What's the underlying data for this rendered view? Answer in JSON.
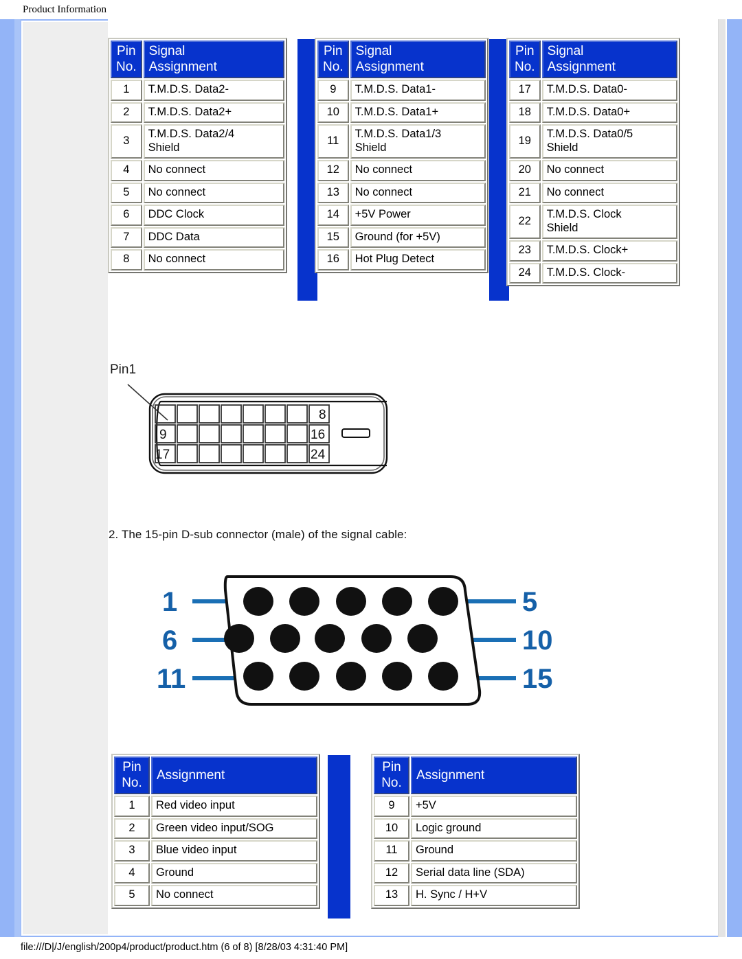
{
  "header": {
    "title": "Product Information"
  },
  "footer": {
    "path": "file:///D|/J/english/200p4/product/product.htm (6 of 8) [8/28/03 4:31:40 PM]"
  },
  "dvi_table": {
    "headers": {
      "pin": "Pin\nNo.",
      "pin_line1": "Pin",
      "pin_line2": "No.",
      "assignment_line1": "Signal",
      "assignment_line2": "Assignment"
    },
    "accent_color": "#0733cc",
    "columns": [
      {
        "rows": [
          {
            "pin": "1",
            "signal": "T.M.D.S. Data2-"
          },
          {
            "pin": "2",
            "signal": "T.M.D.S. Data2+"
          },
          {
            "pin": "3",
            "signal": "T.M.D.S. Data2/4\nShield",
            "signal_l1": "T.M.D.S. Data2/4",
            "signal_l2": "Shield"
          },
          {
            "pin": "4",
            "signal": "No connect"
          },
          {
            "pin": "5",
            "signal": "No connect"
          },
          {
            "pin": "6",
            "signal": "DDC Clock"
          },
          {
            "pin": "7",
            "signal": "DDC Data"
          },
          {
            "pin": "8",
            "signal": "No connect"
          }
        ]
      },
      {
        "rows": [
          {
            "pin": "9",
            "signal": "T.M.D.S. Data1-"
          },
          {
            "pin": "10",
            "signal": "T.M.D.S. Data1+"
          },
          {
            "pin": "11",
            "signal": "T.M.D.S. Data1/3\nShield",
            "signal_l1": "T.M.D.S. Data1/3",
            "signal_l2": "Shield"
          },
          {
            "pin": "12",
            "signal": "No connect"
          },
          {
            "pin": "13",
            "signal": "No connect"
          },
          {
            "pin": "14",
            "signal": "+5V Power"
          },
          {
            "pin": "15",
            "signal": "Ground (for +5V)"
          },
          {
            "pin": "16",
            "signal": "Hot Plug Detect"
          }
        ]
      },
      {
        "rows": [
          {
            "pin": "17",
            "signal": "T.M.D.S. Data0-"
          },
          {
            "pin": "18",
            "signal": "T.M.D.S. Data0+"
          },
          {
            "pin": "19",
            "signal": "T.M.D.S. Data0/5\nShield",
            "signal_l1": "T.M.D.S. Data0/5",
            "signal_l2": "Shield"
          },
          {
            "pin": "20",
            "signal": "No connect"
          },
          {
            "pin": "21",
            "signal": "No connect"
          },
          {
            "pin": "22",
            "signal": "T.M.D.S. Clock\nShield",
            "signal_l1": "T.M.D.S. Clock",
            "signal_l2": "Shield"
          },
          {
            "pin": "23",
            "signal": "T.M.D.S. Clock+"
          },
          {
            "pin": "24",
            "signal": "T.M.D.S. Clock-"
          }
        ]
      }
    ]
  },
  "dvi_diagram": {
    "pin1_label": "Pin1",
    "corner_labels": {
      "top_right": "8",
      "mid_left": "9",
      "mid_right": "16",
      "bottom_left": "17",
      "bottom_right": "24"
    }
  },
  "step": {
    "text": "2. The 15-pin D-sub connector (male) of the signal cable:"
  },
  "dsub_diagram": {
    "labels": {
      "l1": "1",
      "l5": "5",
      "l6": "6",
      "l10": "10",
      "l11": "11",
      "l15": "15"
    },
    "label_color": "#1560a8",
    "leader_color": "#1a6fb5"
  },
  "dsub_table": {
    "headers": {
      "pin_line1": "Pin",
      "pin_line2": "No.",
      "assignment": "Assignment"
    },
    "accent_color": "#0733cc",
    "columns": [
      {
        "rows": [
          {
            "pin": "1",
            "assignment": "Red video input"
          },
          {
            "pin": "2",
            "assignment": "Green video input/SOG"
          },
          {
            "pin": "3",
            "assignment": "Blue video input"
          },
          {
            "pin": "4",
            "assignment": "Ground"
          },
          {
            "pin": "5",
            "assignment": "No connect"
          }
        ]
      },
      {
        "rows": [
          {
            "pin": "9",
            "assignment": "+5V"
          },
          {
            "pin": "10",
            "assignment": "Logic ground"
          },
          {
            "pin": "11",
            "assignment": "Ground"
          },
          {
            "pin": "12",
            "assignment": "Serial data line (SDA)"
          },
          {
            "pin": "13",
            "assignment": "H. Sync / H+V"
          }
        ]
      }
    ]
  }
}
